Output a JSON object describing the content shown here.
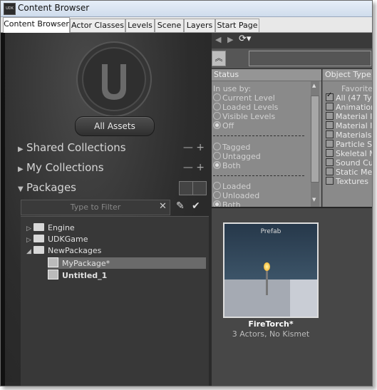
{
  "window": {
    "title": "Content Browser",
    "app_icon": "UDK"
  },
  "tabs": [
    {
      "label": "Content Browser",
      "active": true
    },
    {
      "label": "Actor Classes",
      "active": false
    },
    {
      "label": "Levels",
      "active": false
    },
    {
      "label": "Scene",
      "active": false
    },
    {
      "label": "Layers",
      "active": false
    },
    {
      "label": "Start Page",
      "active": false
    }
  ],
  "left": {
    "logo_icon": "unreal-logo-icon",
    "all_assets": "All Assets",
    "shared_collections": "Shared Collections",
    "my_collections": "My Collections",
    "packages": "Packages",
    "filter_placeholder": "Type to Filter",
    "tree": [
      {
        "label": "Engine",
        "type": "folder",
        "level": 0,
        "expanded": false
      },
      {
        "label": "UDKGame",
        "type": "folder",
        "level": 0,
        "expanded": false
      },
      {
        "label": "NewPackages",
        "type": "folder",
        "level": 0,
        "expanded": true
      },
      {
        "label": "MyPackage*",
        "type": "package",
        "level": 1,
        "selected": true
      },
      {
        "label": "Untitled_1",
        "type": "package",
        "level": 1,
        "selected": false
      }
    ]
  },
  "filters": {
    "status_header": "Status",
    "in_use_by": "In use by:",
    "current_level": "Current Level",
    "loaded_levels": "Loaded Levels",
    "visible_levels": "Visible Levels",
    "off": "Off",
    "tagged": "Tagged",
    "untagged": "Untagged",
    "both": "Both",
    "loaded": "Loaded",
    "unloaded": "Unloaded",
    "both2": "Both",
    "object_type_header": "Object Type",
    "favorites": "Favorite",
    "types": [
      "All (47 Typ",
      "Animation",
      "Material In",
      "Material In",
      "Materials",
      "Particle Sys",
      "Skeletal Me",
      "Sound Cue",
      "Static Mesh",
      "Textures"
    ]
  },
  "asset": {
    "badge": "Prefab",
    "name": "FireTorch*",
    "desc": "3 Actors, No Kismet"
  }
}
